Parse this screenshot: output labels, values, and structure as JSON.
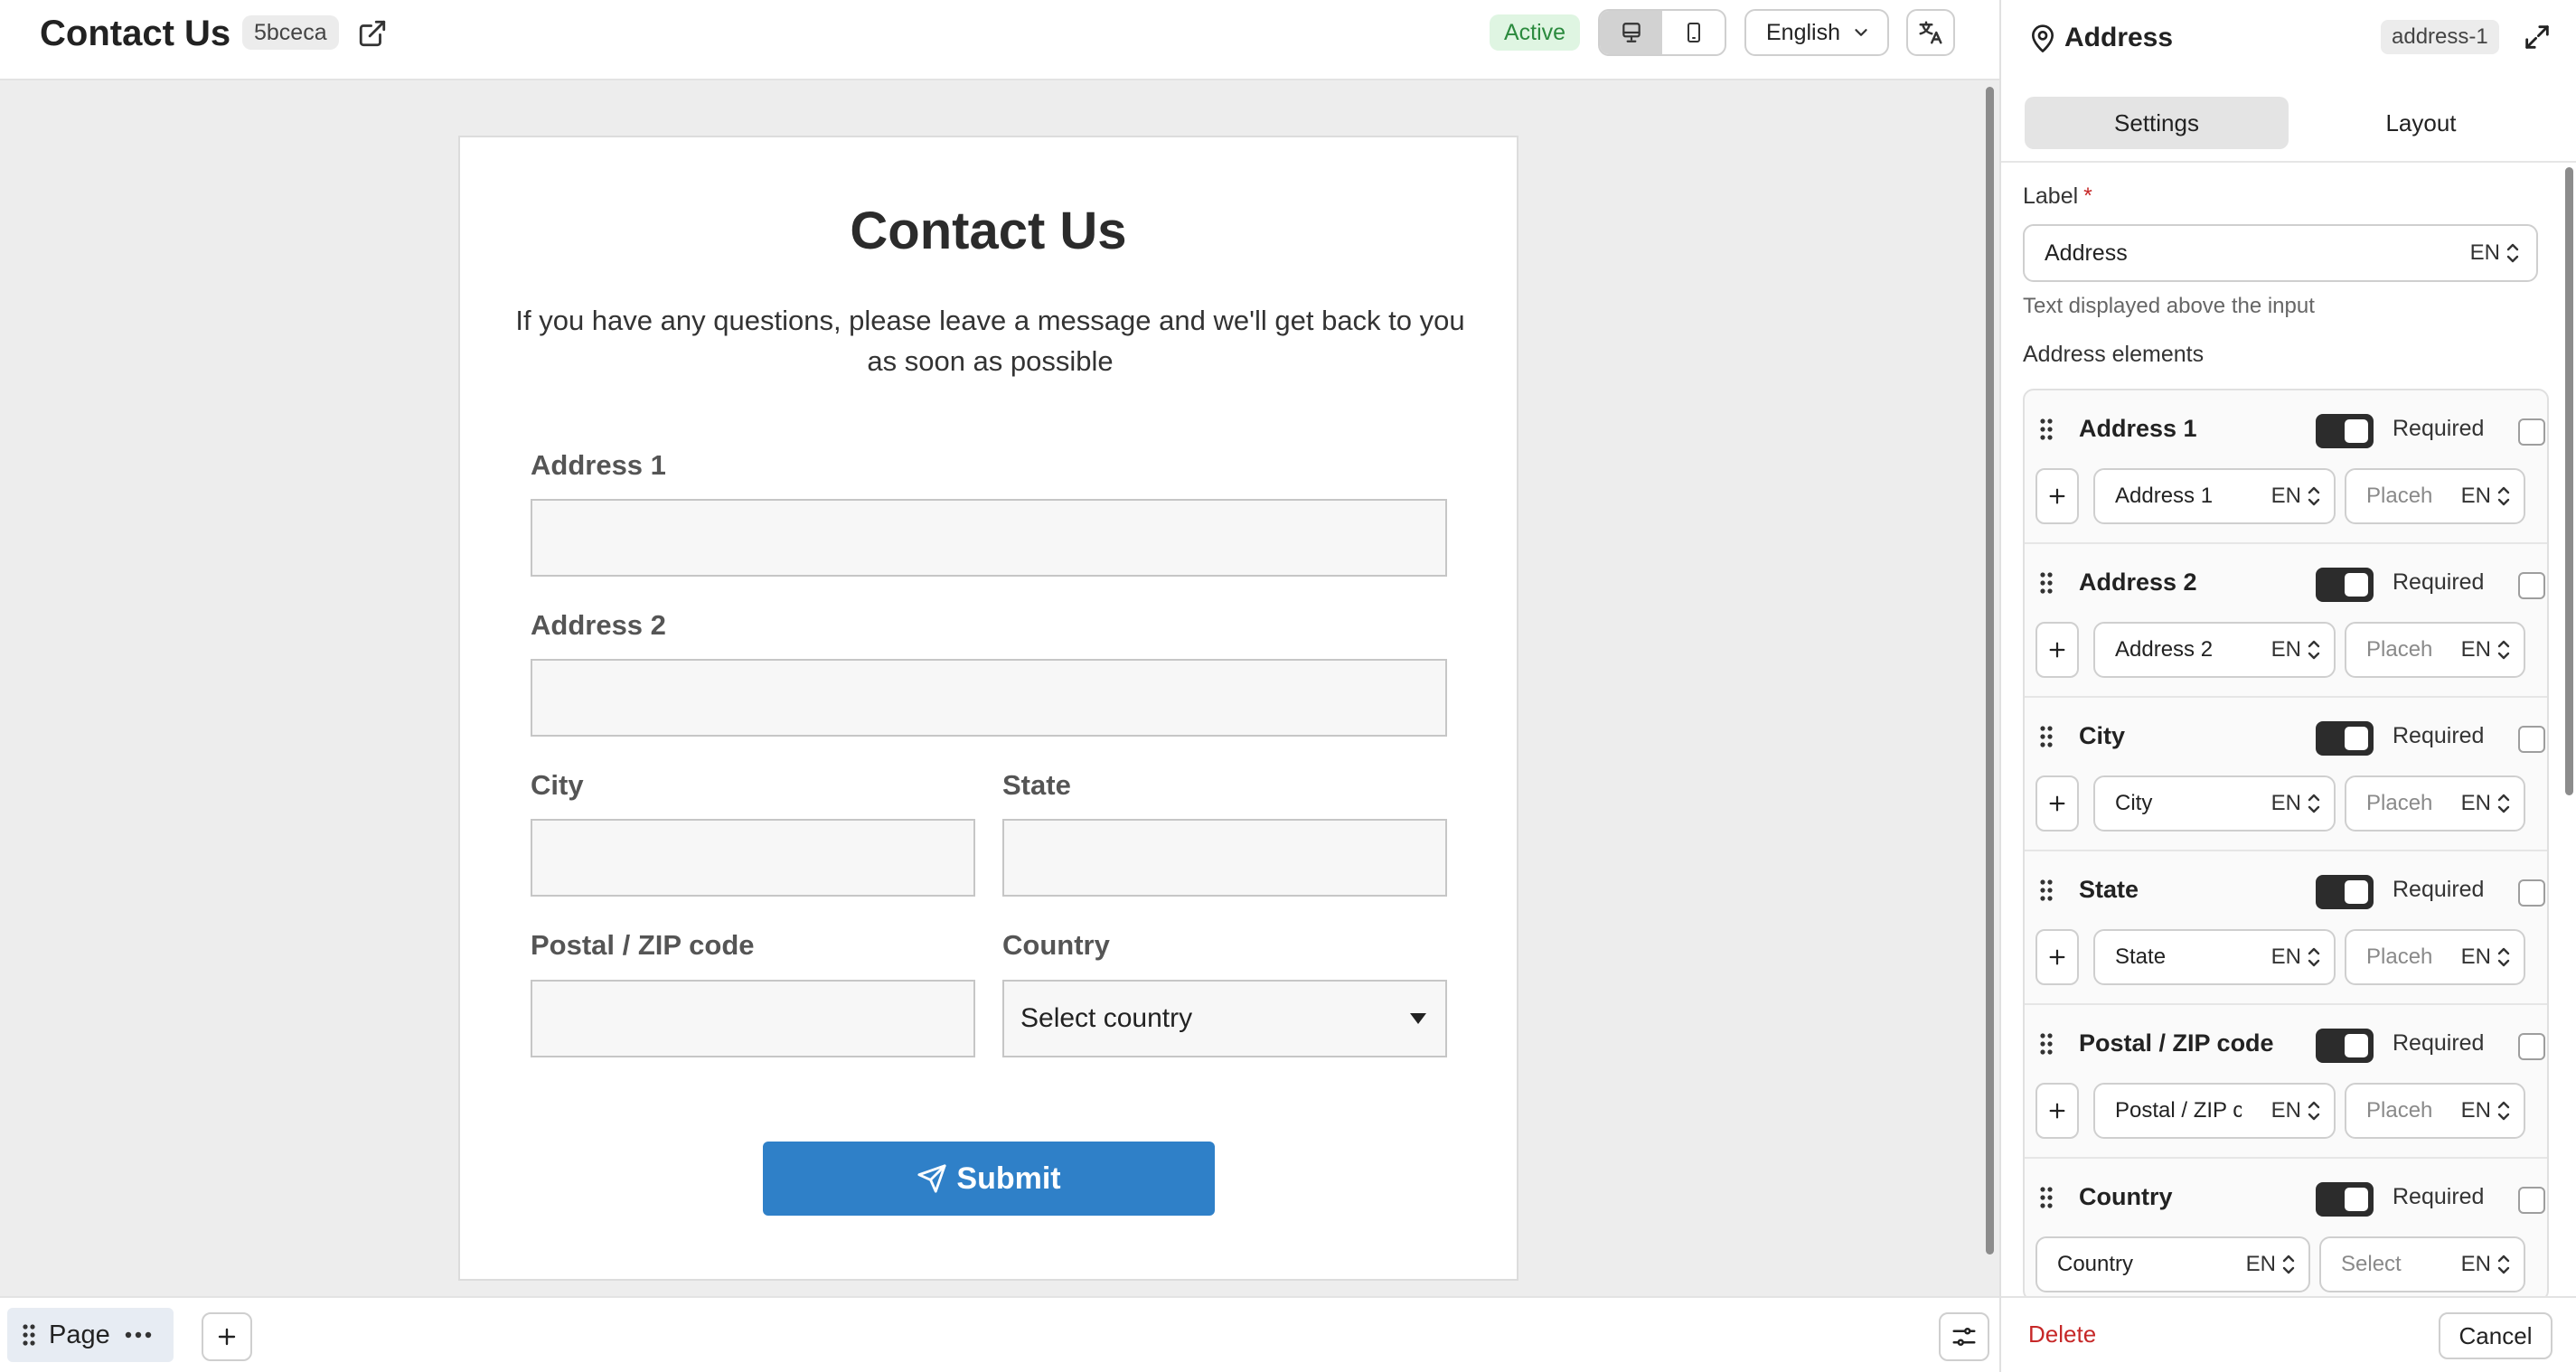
{
  "header": {
    "title": "Contact Us",
    "id_badge": "5bceca",
    "status": "Active",
    "language": "English"
  },
  "form": {
    "title": "Contact Us",
    "subtitle": "If you have any questions, please leave a message and we'll get back to you as soon as possible",
    "fields": {
      "address1": "Address 1",
      "address2": "Address 2",
      "city": "City",
      "state": "State",
      "postal": "Postal / ZIP code",
      "country": "Country"
    },
    "country_select_value": "Select country",
    "submit_label": "Submit",
    "accent_color": "#2f80c8"
  },
  "bottom_bar": {
    "page_label": "Page"
  },
  "panel": {
    "title": "Address",
    "id_badge": "address-1",
    "tabs": [
      "Settings",
      "Layout"
    ],
    "active_tab": "Settings",
    "label_field": {
      "label": "Label",
      "required_mark": "*",
      "value": "Address",
      "lang": "EN",
      "help": "Text displayed above the input"
    },
    "elements_heading": "Address elements",
    "elements": [
      {
        "name": "Address 1",
        "required_label": "Required",
        "label_value": "Address 1",
        "label_lang": "EN",
        "placeholder_value": "Placeholder",
        "placeholder_lang": "EN"
      },
      {
        "name": "Address 2",
        "required_label": "Required",
        "label_value": "Address 2",
        "label_lang": "EN",
        "placeholder_value": "Placeholder",
        "placeholder_lang": "EN"
      },
      {
        "name": "City",
        "required_label": "Required",
        "label_value": "City",
        "label_lang": "EN",
        "placeholder_value": "Placeholder",
        "placeholder_lang": "EN"
      },
      {
        "name": "State",
        "required_label": "Required",
        "label_value": "State",
        "label_lang": "EN",
        "placeholder_value": "Placeholder",
        "placeholder_lang": "EN"
      },
      {
        "name": "Postal / ZIP code",
        "required_label": "Required",
        "label_value": "Postal / ZIP code",
        "label_lang": "EN",
        "placeholder_value": "Placeholder",
        "placeholder_lang": "EN"
      },
      {
        "name": "Country",
        "required_label": "Required",
        "label_value": "Country",
        "label_lang": "EN",
        "placeholder_value": "Select",
        "placeholder_lang": "EN"
      }
    ],
    "delete_label": "Delete",
    "cancel_label": "Cancel"
  }
}
